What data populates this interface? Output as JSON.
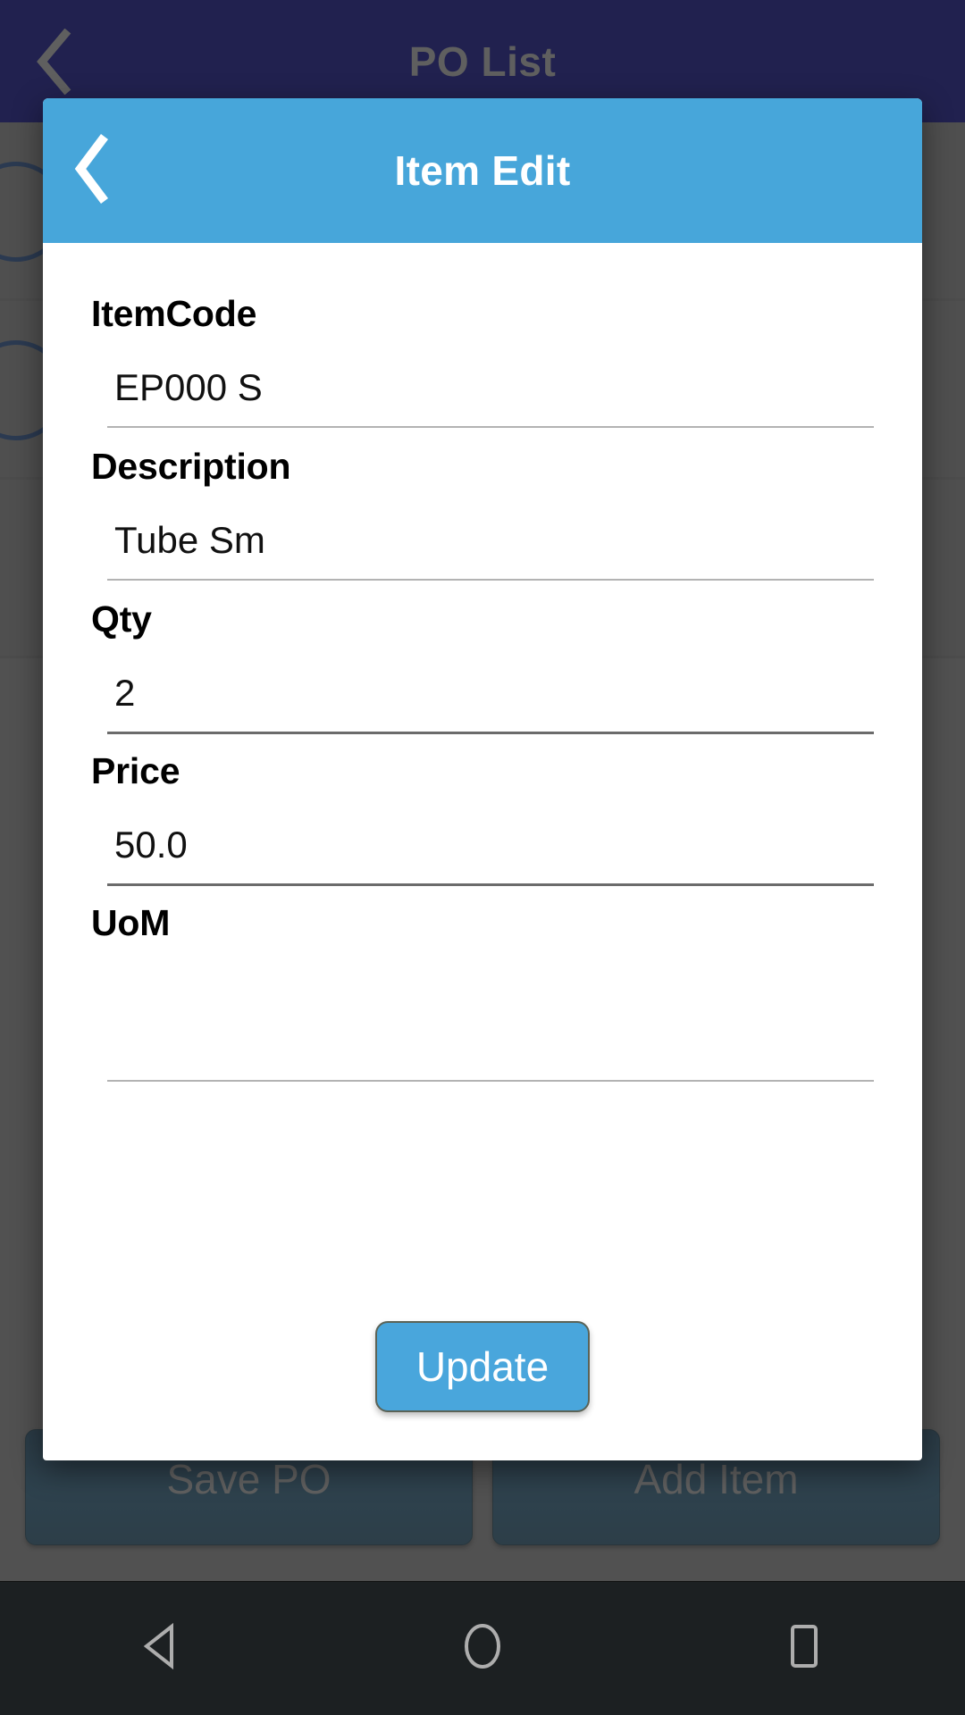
{
  "background_app": {
    "appbar": {
      "back_icon": "chevron-left-icon",
      "title": "PO List"
    },
    "rows": [
      {
        "indicator_icon": "circle-outline-icon"
      },
      {
        "indicator_icon": "circle-outline-icon"
      }
    ],
    "buttons": [
      {
        "label": "Save PO",
        "name": "save-po-button"
      },
      {
        "label": "Add Item",
        "name": "add-item-button"
      }
    ]
  },
  "dialog": {
    "header": {
      "back_icon": "chevron-left-icon",
      "title": "Item Edit"
    },
    "fields": [
      {
        "label": "ItemCode",
        "value": "EP000 S",
        "focused": false
      },
      {
        "label": "Description",
        "value": "Tube Sm",
        "focused": false
      },
      {
        "label": "Qty",
        "value": "2",
        "focused": true
      },
      {
        "label": "Price",
        "value": "50.0",
        "focused": true
      },
      {
        "label": "UoM",
        "value": "",
        "focused": false
      }
    ],
    "primary_action": {
      "label": "Update"
    }
  },
  "navbar": {
    "back": "triangle-back-icon",
    "home": "circle-home-icon",
    "recents": "square-recents-icon"
  },
  "colors": {
    "appbar_navy": "#000066",
    "dialog_blue": "#47a6da",
    "update_button": "#49a6dc",
    "bottom_button": "#1d4963",
    "scrim": "#5e5e5e",
    "navbar": "#1c2022"
  }
}
